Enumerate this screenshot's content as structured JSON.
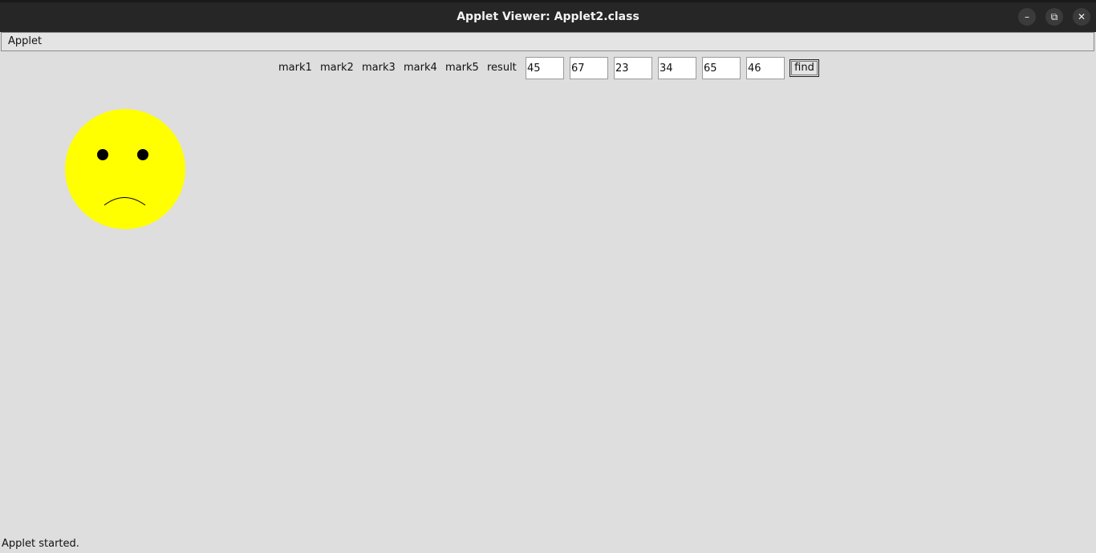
{
  "window": {
    "title": "Applet Viewer: Applet2.class",
    "controls": {
      "minimize_glyph": "–",
      "maximize_glyph": "⧉",
      "close_glyph": "✕"
    }
  },
  "menubar": {
    "items": [
      {
        "label": "Applet"
      }
    ]
  },
  "form": {
    "labels": [
      "mark1",
      "mark2",
      "mark3",
      "mark4",
      "mark5",
      "result"
    ],
    "fields": [
      {
        "name": "mark1",
        "value": "45"
      },
      {
        "name": "mark2",
        "value": "67"
      },
      {
        "name": "mark3",
        "value": "23"
      },
      {
        "name": "mark4",
        "value": "34"
      },
      {
        "name": "mark5",
        "value": "65"
      },
      {
        "name": "result",
        "value": "46"
      }
    ],
    "find_label": "find"
  },
  "drawing": {
    "face": "sad-face",
    "face_color": "#ffff00",
    "feature_color": "#000000"
  },
  "status": {
    "text": "Applet started."
  }
}
